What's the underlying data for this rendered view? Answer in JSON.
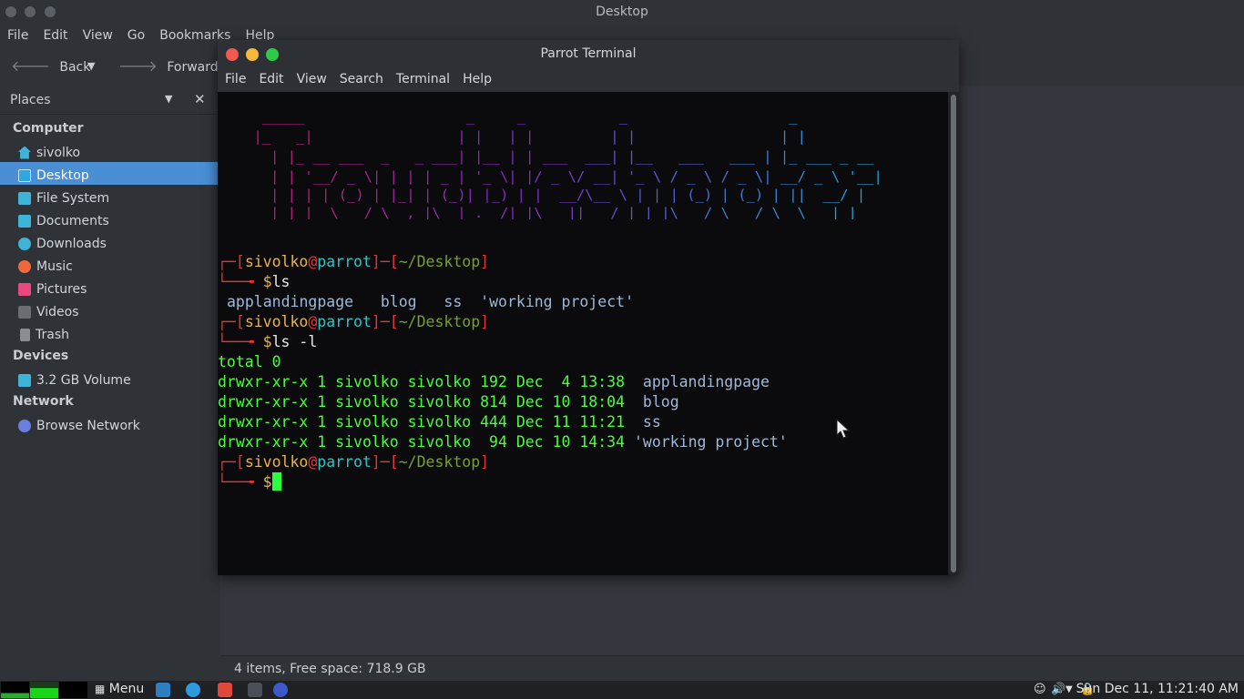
{
  "file_manager": {
    "window_title": "Desktop",
    "menu": [
      "File",
      "Edit",
      "View",
      "Go",
      "Bookmarks",
      "Help"
    ],
    "toolbar": {
      "back_label": "Back",
      "forward_label": "Forward"
    },
    "places": {
      "header": "Places"
    },
    "sidebar": {
      "computer_label": "Computer",
      "computer_items": [
        {
          "label": "sivolko",
          "icon": "home-icon"
        },
        {
          "label": "Desktop",
          "icon": "desktop-icon"
        },
        {
          "label": "File System",
          "icon": "drive-icon"
        },
        {
          "label": "Documents",
          "icon": "folder-icon"
        },
        {
          "label": "Downloads",
          "icon": "download-icon"
        },
        {
          "label": "Music",
          "icon": "music-icon"
        },
        {
          "label": "Pictures",
          "icon": "pictures-icon"
        },
        {
          "label": "Videos",
          "icon": "videos-icon"
        },
        {
          "label": "Trash",
          "icon": "trash-icon"
        }
      ],
      "devices_label": "Devices",
      "device_items": [
        {
          "label": "3.2 GB Volume",
          "icon": "volume-icon"
        }
      ],
      "network_label": "Network",
      "network_items": [
        {
          "label": "Browse Network",
          "icon": "network-icon"
        }
      ]
    },
    "status": "4 items, Free space: 718.9 GB"
  },
  "terminal": {
    "title": "Parrot Terminal",
    "menu": [
      "File",
      "Edit",
      "View",
      "Search",
      "Terminal",
      "Help"
    ],
    "banner_art": [
      "  _____                   _     _           _                   _      ",
      " |_   _|                 | |   | |         | |                 | |     ",
      "   | |_ __ ___  _   _ ___| |__ | | ___  ___| |__   ___   ___ | |_ ___ _ __",
      "   | | '__/ _ \\| | | | _ | '_ \\| |/ _ \\/ __| '_ \\ / _ \\ / _ \\| __/ _ \\ '__|",
      "   | | | | (_) | |_| | (_)| |_) | |  __/\\__ \\ | | | (_) | (_) | ||  __/ |",
      "   |_|_|  \\___/ \\__,_|\\__|_.__/|_|\\___||___/_| |_|\\___/ \\___/ \\__\\___|_|"
    ],
    "prompt": {
      "user": "sivolko",
      "at": "@",
      "host": "parrot",
      "dir": "~/Desktop"
    },
    "cmd1": "ls",
    "ls_output": "applandingpage   blog   ss  'working project'",
    "cmd2": "ls -l",
    "total": "total 0",
    "listing": [
      {
        "perm": "drwxr-xr-x 1 sivolko sivolko 192 Dec  4 13:38  ",
        "name": "applandingpage"
      },
      {
        "perm": "drwxr-xr-x 1 sivolko sivolko 814 Dec 10 18:04  ",
        "name": "blog"
      },
      {
        "perm": "drwxr-xr-x 1 sivolko sivolko 444 Dec 11 11:21  ",
        "name": "ss"
      },
      {
        "perm": "drwxr-xr-x 1 sivolko sivolko  94 Dec 10 14:34 ",
        "name": "'working project'"
      }
    ],
    "prompt_symbol": "$"
  },
  "taskbar": {
    "menu_label": "Menu",
    "clock": "Sun Dec 11, 11:21:40 AM"
  },
  "colors": {
    "selection": "#4a8fd4",
    "prompt_red": "#e43636",
    "user_yellow": "#e6b450",
    "host_cyan": "#2ec4c4",
    "listing_green": "#49ff3a"
  }
}
